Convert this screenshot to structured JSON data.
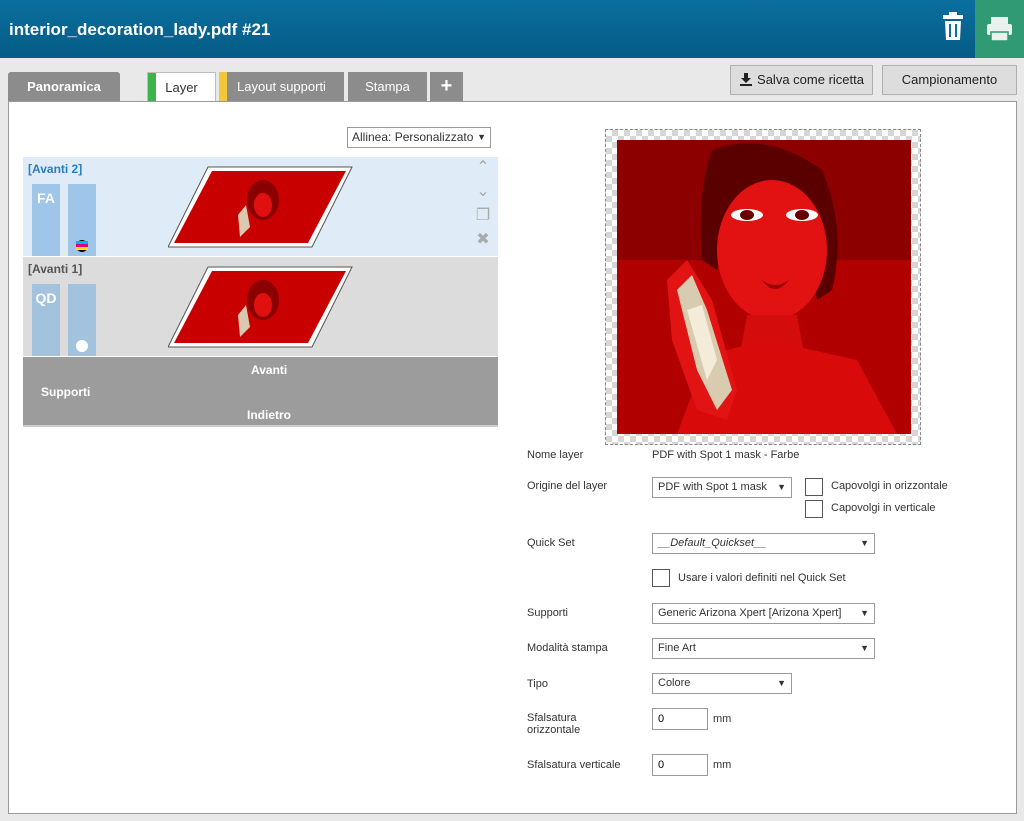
{
  "window": {
    "title": "interior_decoration_lady.pdf #21"
  },
  "tabs": [
    {
      "label": "Panoramica"
    },
    {
      "label": "Layer"
    },
    {
      "label": "Layout supporti"
    },
    {
      "label": "Stampa"
    },
    {
      "label": "+"
    }
  ],
  "toolbar": {
    "save_label": "Salva come ricetta",
    "sampling_label": "Campionamento"
  },
  "align": {
    "value": "Allinea: Personalizzato"
  },
  "layers": [
    {
      "name": "[Avanti 2]",
      "badge": "FA",
      "indicator": "cmyk-dot"
    },
    {
      "name": "[Avanti 1]",
      "badge": "QD",
      "indicator": "white-dot"
    }
  ],
  "supports": {
    "label": "Supporti",
    "front": "Avanti",
    "back": "Indietro"
  },
  "form": {
    "layer_name_label": "Nome layer",
    "layer_name_value": "PDF with Spot 1 mask - Farbe",
    "origin_label": "Origine del layer",
    "origin_value": "PDF with Spot 1 mask",
    "flip_h_label": "Capovolgi in orizzontale",
    "flip_v_label": "Capovolgi in verticale",
    "quickset_label": "Quick Set",
    "quickset_value": "__Default_Quickset__",
    "use_quickset_label": "Usare i valori definiti nel Quick Set",
    "media_label": "Supporti",
    "media_value": "Generic Arizona Xpert [Arizona Xpert]",
    "mode_label": "Modalità stampa",
    "mode_value": "Fine Art",
    "type_label": "Tipo",
    "type_value": "Colore",
    "offset_h_label_1": "Sfalsatura",
    "offset_h_label_2": "orizzontale",
    "offset_h_value": "0",
    "offset_v_label": "Sfalsatura verticale",
    "offset_v_value": "0",
    "unit": "mm"
  },
  "colors": {
    "titlebar": "#0a6f9e",
    "print": "#2f9a73",
    "layer_tab": "#3cb44b",
    "layout_tab": "#f3c73b",
    "image": "#c80000"
  }
}
